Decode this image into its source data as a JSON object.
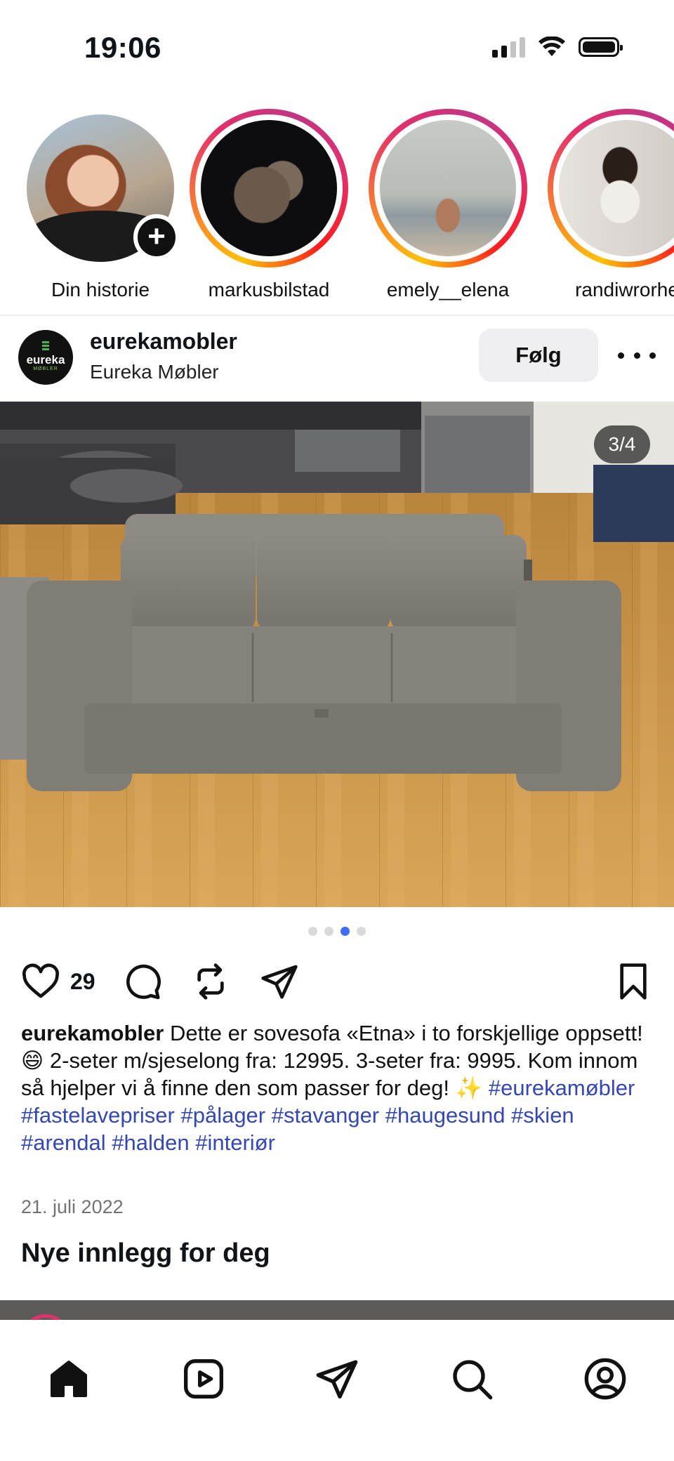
{
  "status_bar": {
    "time": "19:06",
    "icons": [
      "cellular-signal-icon",
      "wifi-icon",
      "battery-icon"
    ]
  },
  "stories": [
    {
      "label": "Din historie",
      "has_ring": false,
      "has_add_button": true
    },
    {
      "label": "markusbilstad",
      "has_ring": true
    },
    {
      "label": "emely__elena",
      "has_ring": true
    },
    {
      "label": "randiwrorhe",
      "has_ring": true
    }
  ],
  "post": {
    "username": "eurekamobler",
    "subtitle": "Eureka Møbler",
    "avatar_logo": {
      "word": "eureka",
      "sub": "MØBLER"
    },
    "follow_label": "Følg",
    "image_counter": "3/4",
    "carousel": {
      "count": 4,
      "active_index": 2
    },
    "like_count": "29",
    "caption": {
      "username": "eurekamobler",
      "text": "Dette er sovesofa «Etna» i to forskjellige oppsett! 😄  2-seter m/sjeselong fra: 12995. 3-seter fra: 9995. Kom innom så hjelper vi å finne den som passer for deg! ✨",
      "hashtags": [
        "#eurekamøbler",
        "#fastelavepriser",
        "#pålager",
        "#stavanger",
        "#haugesund",
        "#skien",
        "#arendal",
        "#halden",
        "#interiør"
      ]
    },
    "date": "21. juli 2022"
  },
  "section_title": "Nye innlegg for deg",
  "bottom_nav": [
    "home-icon",
    "reels-icon",
    "direct-message-icon",
    "search-icon",
    "profile-icon"
  ],
  "colors": {
    "story_ring": [
      "#ffc107",
      "#f77737",
      "#e1306c",
      "#c13584"
    ],
    "hashtag": "#3547b5",
    "carousel_active": "#3e6cf2",
    "follow_bg": "#efeff2"
  }
}
